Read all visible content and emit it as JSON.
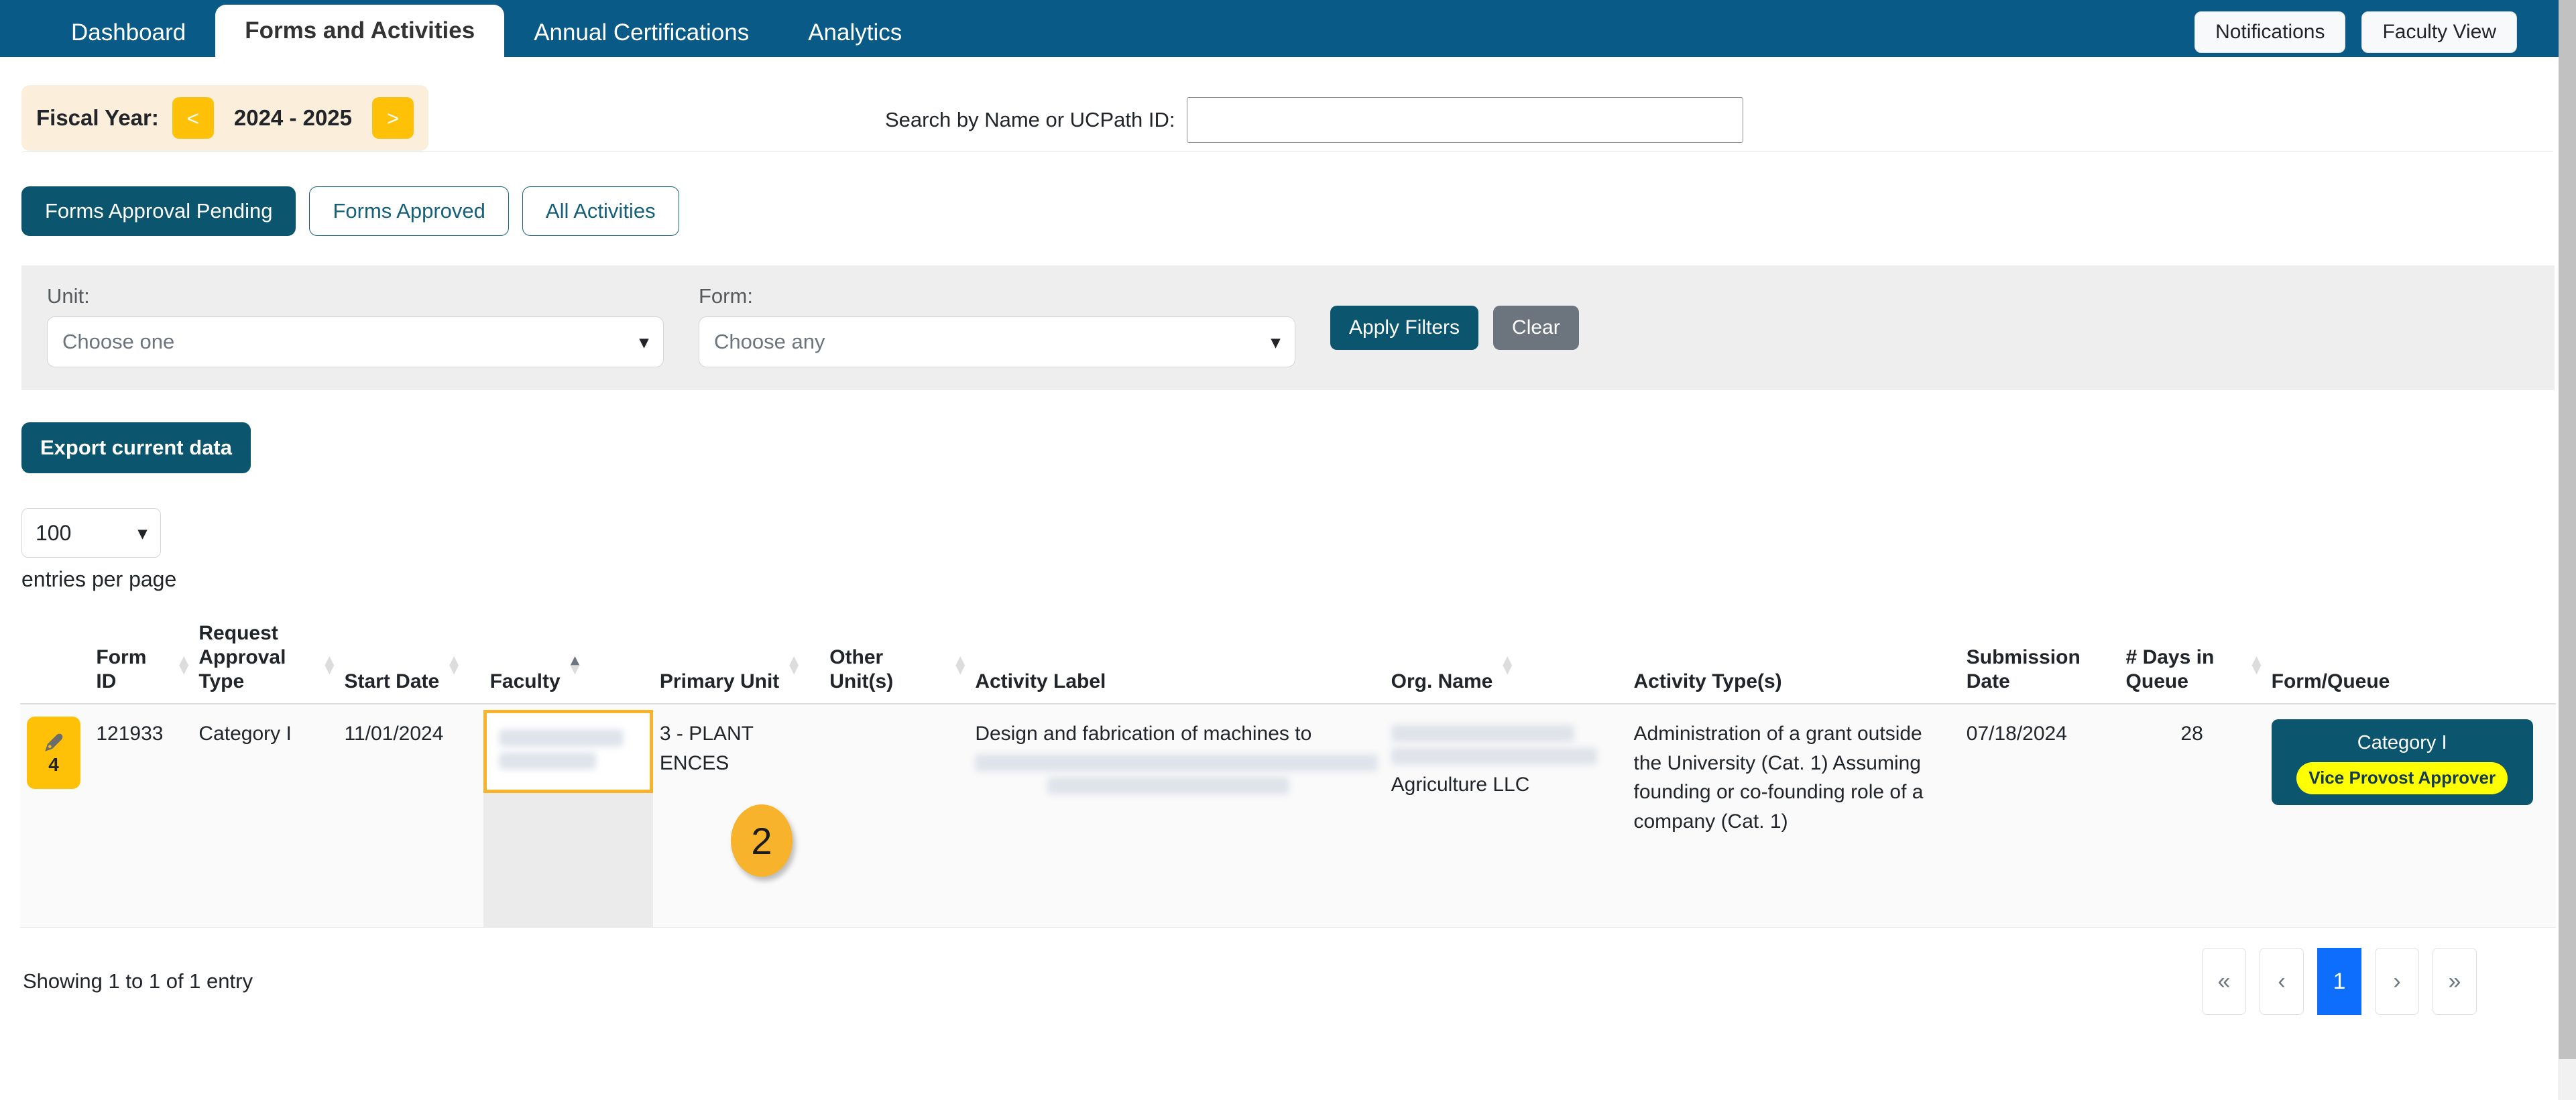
{
  "nav": {
    "tabs": [
      {
        "label": "Dashboard",
        "active": false
      },
      {
        "label": "Forms and Activities",
        "active": true
      },
      {
        "label": "Annual Certifications",
        "active": false
      },
      {
        "label": "Analytics",
        "active": false
      }
    ],
    "notifications_label": "Notifications",
    "faculty_view_label": "Faculty View"
  },
  "fiscal_year": {
    "label": "Fiscal Year:",
    "prev_label": "<",
    "next_label": ">",
    "value": "2024 - 2025"
  },
  "search": {
    "label": "Search by Name or UCPath ID:",
    "value": "",
    "placeholder": ""
  },
  "segments": [
    {
      "label": "Forms Approval Pending",
      "active": true
    },
    {
      "label": "Forms Approved",
      "active": false
    },
    {
      "label": "All Activities",
      "active": false
    }
  ],
  "filters": {
    "unit_label": "Unit:",
    "unit_value": "Choose one",
    "form_label": "Form:",
    "form_value": "Choose any",
    "apply_label": "Apply Filters",
    "clear_label": "Clear"
  },
  "export": {
    "label": "Export current data"
  },
  "entries": {
    "value": "100",
    "caption": "entries per page"
  },
  "table": {
    "columns": [
      {
        "label": "Form ID",
        "sortable": true
      },
      {
        "label": "Request Approval Type",
        "sortable": true
      },
      {
        "label": "Start Date",
        "sortable": true
      },
      {
        "label": "Faculty",
        "sortable": true,
        "sorted": "asc"
      },
      {
        "label": "Primary Unit",
        "sortable": true
      },
      {
        "label": "Other Unit(s)",
        "sortable": true
      },
      {
        "label": "Activity Label",
        "sortable": false
      },
      {
        "label": "Org. Name",
        "sortable": true
      },
      {
        "label": "Activity Type(s)",
        "sortable": false
      },
      {
        "label": "Submission Date",
        "sortable": false
      },
      {
        "label": "# Days in Queue",
        "sortable": true
      },
      {
        "label": "Form/Queue",
        "sortable": false
      }
    ],
    "rows": [
      {
        "badge_count": "4",
        "badge_icon": "pen-tag-icon",
        "form_id": "121933",
        "request_approval_type": "Category I",
        "start_date": "11/01/2024",
        "faculty": "",
        "primary_unit": "3 - PLANT\nENCES",
        "other_units": "",
        "activity_label": "Design and fabrication of machines to",
        "org_name": "Agriculture LLC",
        "activity_types": "Administration of a grant outside the University (Cat. 1) Assuming founding or co-founding role of a company (Cat. 1)",
        "submission_date": "07/18/2024",
        "days_in_queue": "28",
        "queue_title": "Category I",
        "queue_pill": "Vice Provost Approver"
      }
    ]
  },
  "annotations": [
    {
      "label": "2",
      "name": "step-marker-2"
    }
  ],
  "footer": {
    "showing": "Showing 1 to 1 of 1 entry",
    "pager": [
      {
        "label": "«",
        "name": "first-page",
        "current": false
      },
      {
        "label": "‹",
        "name": "prev-page",
        "current": false
      },
      {
        "label": "1",
        "name": "page-1",
        "current": true
      },
      {
        "label": "›",
        "name": "next-page",
        "current": false
      },
      {
        "label": "»",
        "name": "last-page",
        "current": false
      }
    ]
  },
  "colors": {
    "nav_blue": "#0a5a87",
    "accent_teal": "#0c556e",
    "accent_yellow": "#ffc107",
    "highlight_orange": "#f7b32b",
    "pill_yellow": "#ffff00",
    "pager_blue": "#0d6efd"
  }
}
